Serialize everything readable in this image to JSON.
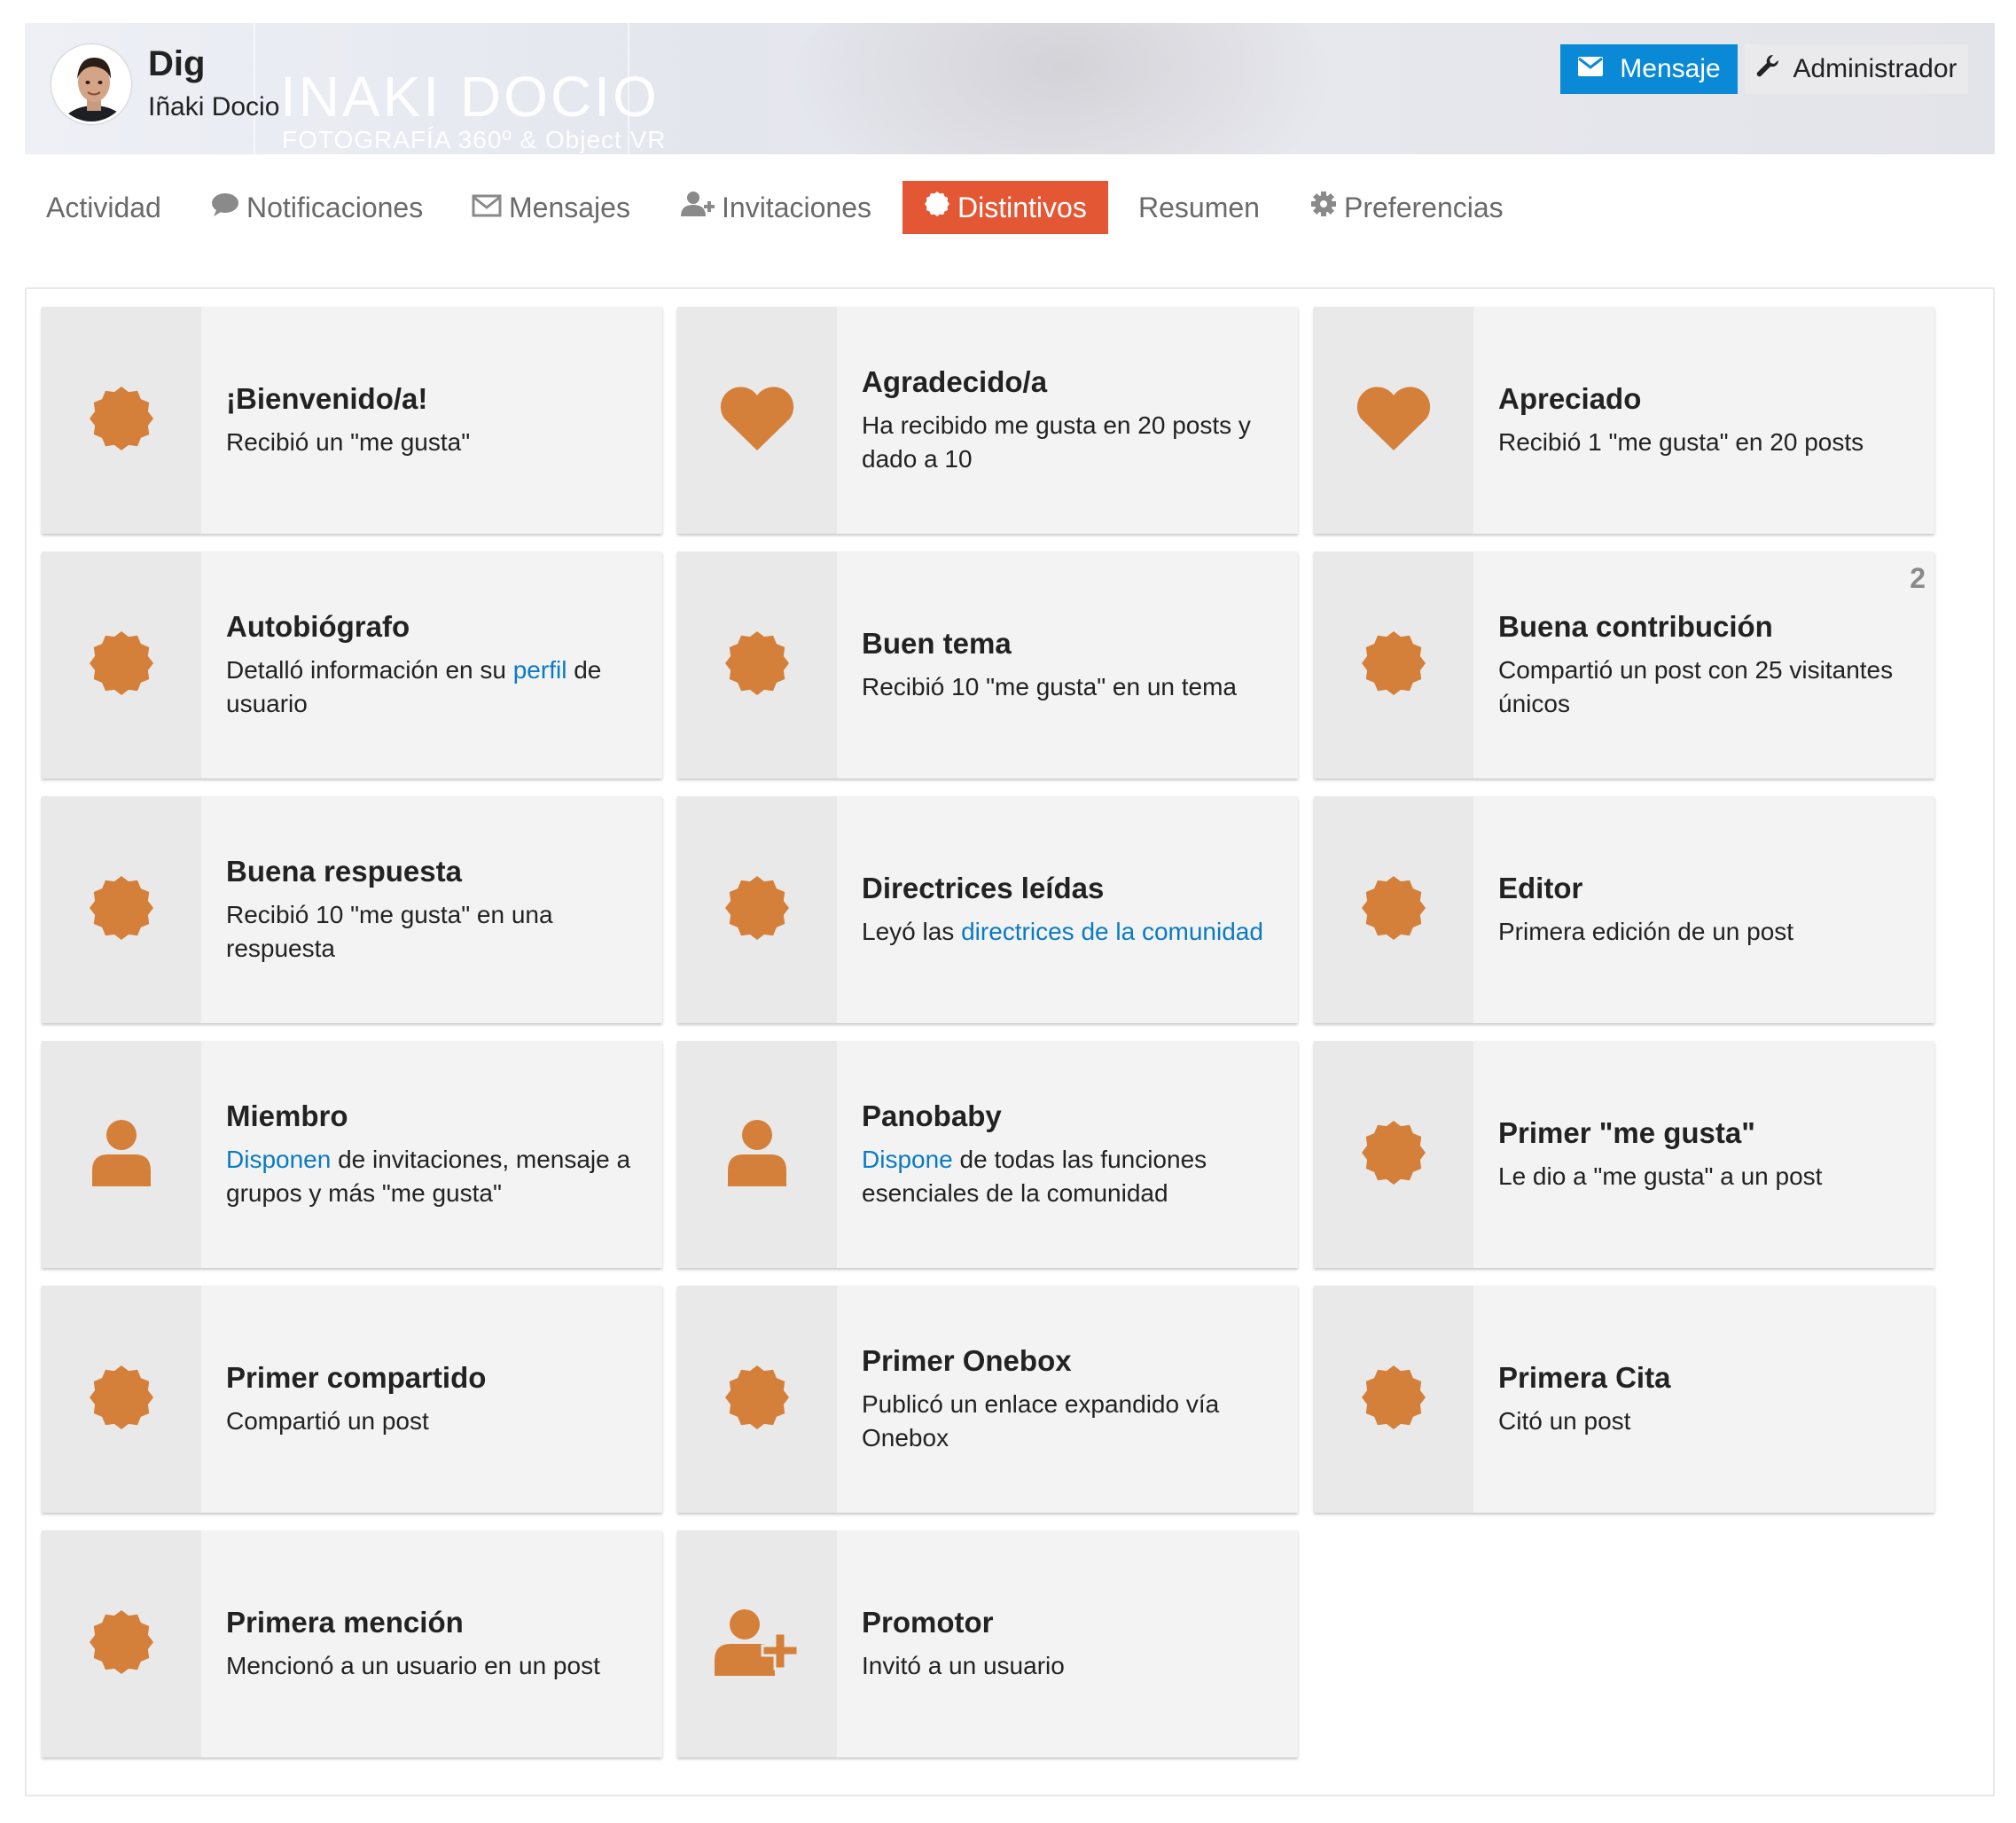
{
  "header": {
    "username": "Dig",
    "full_name": "Iñaki Docio",
    "banner_title": "INAKI DOCIO",
    "banner_subtitle": "FOTOGRAFÍA 360º & Object VR",
    "message_button": "Mensaje",
    "admin_button": "Administrador",
    "accent_color": "#0a8ad6"
  },
  "nav": {
    "items": [
      {
        "label": "Actividad",
        "icon": ""
      },
      {
        "label": "Notificaciones",
        "icon": "speech-bubble-icon"
      },
      {
        "label": "Mensajes",
        "icon": "envelope-icon"
      },
      {
        "label": "Invitaciones",
        "icon": "user-plus-icon"
      },
      {
        "label": "Distintivos",
        "icon": "certificate-icon",
        "active": true
      },
      {
        "label": "Resumen",
        "icon": ""
      },
      {
        "label": "Preferencias",
        "icon": "gear-icon"
      }
    ],
    "active_color": "#e45735"
  },
  "badges": [
    {
      "title": "¡Bienvenido/a!",
      "desc": "Recibió un \"me gusta\"",
      "icon": "certificate-icon"
    },
    {
      "title": "Agradecido/a",
      "desc": "Ha recibido me gusta en 20 posts y dado a 10",
      "icon": "heart-icon"
    },
    {
      "title": "Apreciado",
      "desc": "Recibió 1 \"me gusta\" en 20 posts",
      "icon": "heart-icon"
    },
    {
      "title": "Autobiógrafo",
      "desc_before": "Detalló información en su ",
      "desc_link": "perfil",
      "desc_after": " de usuario",
      "icon": "certificate-icon"
    },
    {
      "title": "Buen tema",
      "desc": "Recibió 10 \"me gusta\" en un tema",
      "icon": "certificate-icon"
    },
    {
      "title": "Buena contribución",
      "desc": "Compartió un post con 25 visitantes únicos",
      "icon": "certificate-icon",
      "count": "2"
    },
    {
      "title": "Buena respuesta",
      "desc": "Recibió 10 \"me gusta\" en una respuesta",
      "icon": "certificate-icon"
    },
    {
      "title": "Directrices leídas",
      "desc_before": "Leyó las ",
      "desc_link": "directrices de la comunidad",
      "desc_after": "",
      "icon": "certificate-icon"
    },
    {
      "title": "Editor",
      "desc": "Primera edición de un post",
      "icon": "certificate-icon"
    },
    {
      "title": "Miembro",
      "desc_before": "",
      "desc_link": "Disponen",
      "desc_after": " de invitaciones, mensaje a grupos y más \"me gusta\"",
      "icon": "user-icon"
    },
    {
      "title": "Panobaby",
      "desc_before": "",
      "desc_link": "Dispone",
      "desc_after": " de todas las funciones esenciales de la comunidad",
      "icon": "user-icon"
    },
    {
      "title": "Primer \"me gusta\"",
      "desc": "Le dio a \"me gusta\" a un post",
      "icon": "certificate-icon"
    },
    {
      "title": "Primer compartido",
      "desc": "Compartió un post",
      "icon": "certificate-icon"
    },
    {
      "title": "Primer Onebox",
      "desc": "Publicó un enlace expandido vía Onebox",
      "icon": "certificate-icon"
    },
    {
      "title": "Primera Cita",
      "desc": "Citó un post",
      "icon": "certificate-icon"
    },
    {
      "title": "Primera mención",
      "desc": "Mencionó a un usuario en un post",
      "icon": "certificate-icon"
    },
    {
      "title": "Promotor",
      "desc": "Invitó a un usuario",
      "icon": "user-plus-icon"
    }
  ],
  "colors": {
    "badge_icon": "#d4803a",
    "link": "#0a7bc2"
  }
}
